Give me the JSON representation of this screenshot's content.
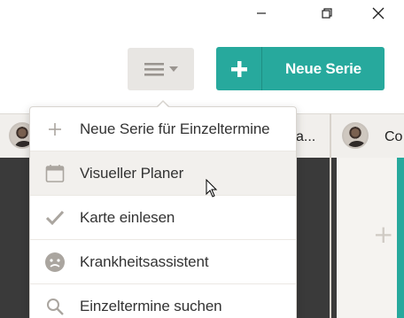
{
  "window": {
    "controls": [
      "minimize-icon",
      "maximize-icon",
      "close-icon"
    ]
  },
  "toolbar": {
    "menu_icon": "hamburger-icon",
    "new_series_label": "Neue Serie",
    "accent": "#27a99d"
  },
  "calendar": {
    "columns": [
      {
        "name": "",
        "avatar": true
      },
      {
        "name": "a...",
        "avatar": false
      },
      {
        "name": "Co",
        "avatar": true
      }
    ]
  },
  "menu": {
    "items": [
      {
        "label": "Neue Serie für Einzeltermine",
        "icon": "plus-icon"
      },
      {
        "label": "Visueller Planer",
        "icon": "calendar-icon",
        "hovered": true
      },
      {
        "label": "Karte einlesen",
        "icon": "checkmark-icon"
      },
      {
        "label": "Krankheitsassistent",
        "icon": "sick-face-icon"
      },
      {
        "label": "Einzeltermine suchen",
        "icon": "search-icon"
      }
    ]
  }
}
